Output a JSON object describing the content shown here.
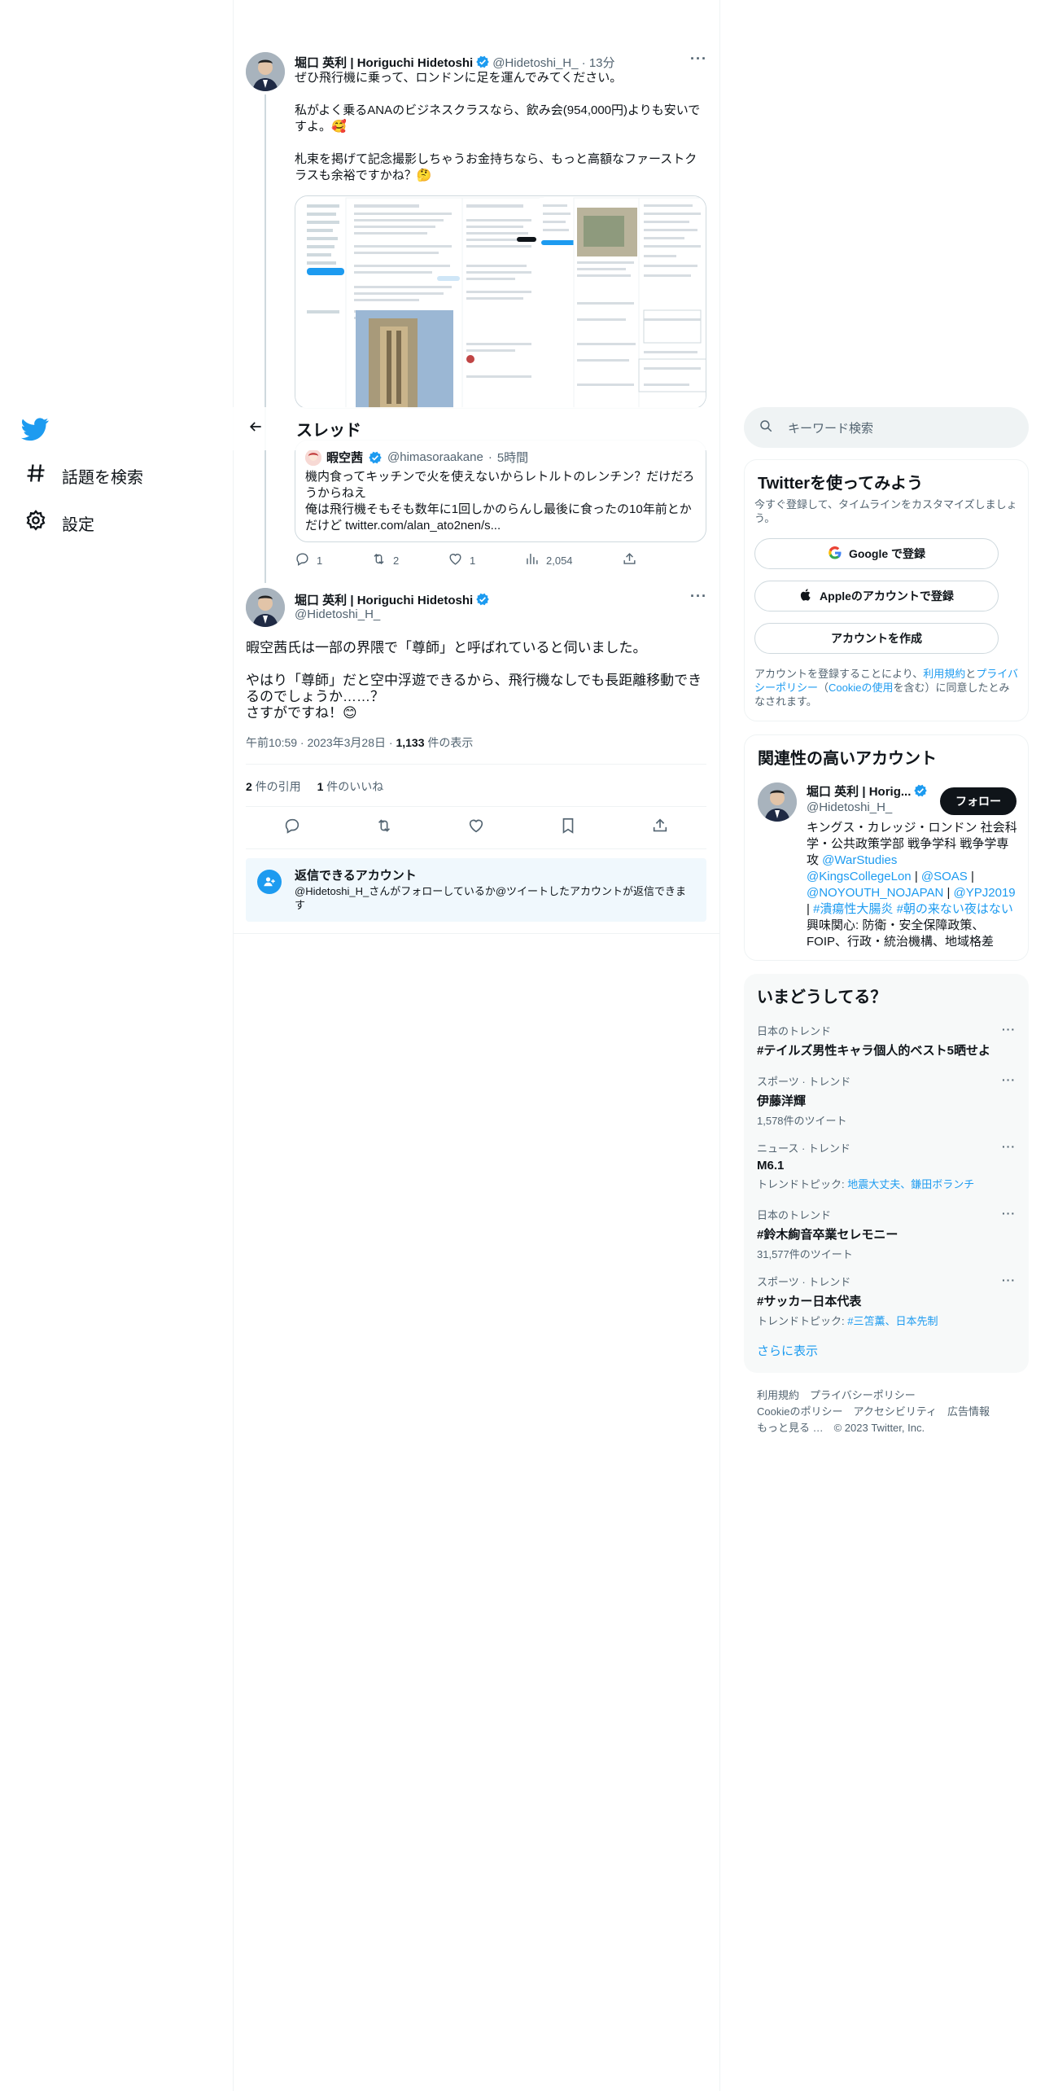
{
  "nav": {
    "explore_label": "話題を検索",
    "settings_label": "設定"
  },
  "thread_header": {
    "title": "スレッド"
  },
  "parent_tweet": {
    "name": "堀口 英利 | Horiguchi Hidetoshi",
    "handle": "@Hidetoshi_H_",
    "time": "13分",
    "text": "ぜひ飛行機に乗って、ロンドンに足を運んでみてください。\n\n私がよく乗るANAのビジネスクラスなら、飲み会(954,000円)よりも安いですよ。🥰\n\n札束を掲げて記念撮影しちゃうお金持ちなら、もっと高額なファーストクラスも余裕ですかね？🤔",
    "quote": {
      "name": "暇空茜",
      "handle": "@himasoraakane",
      "time": "5時間",
      "text": "機内食ってキッチンで火を使えないからレトルトのレンチン？だけだろうからねえ\n俺は飛行機そもそも数年に1回しかのらんし最後に食ったの10年前とかだけど twitter.com/alan_ato2nen/s..."
    },
    "actions": {
      "reply": "1",
      "retweet": "2",
      "like": "1",
      "views": "2,054"
    }
  },
  "main_tweet": {
    "name": "堀口 英利 | Horiguchi Hidetoshi",
    "handle": "@Hidetoshi_H_",
    "text": "暇空茜氏は一部の界隈で「尊師」と呼ばれていると伺いました。\n\nやはり「尊師」だと空中浮遊できるから、飛行機なしでも長距離移動できるのでしょうか……？\nさすがですね！😊",
    "time": "午前10:59",
    "date": "2023年3月28日",
    "views_count": "1,133",
    "views_label": "件の表示",
    "quotes_count": "2",
    "quotes_label": "件の引用",
    "likes_count": "1",
    "likes_label": "件のいいね"
  },
  "reply_restriction": {
    "title": "返信できるアカウント",
    "text": "@Hidetoshi_H_さんがフォローしているか@ツイートしたアカウントが返信できます"
  },
  "search": {
    "placeholder": "キーワード検索"
  },
  "signup": {
    "title": "Twitterを使ってみよう",
    "subtitle": "今すぐ登録して、タイムラインをカスタマイズしましょう。",
    "google": "Google で登録",
    "apple": "Appleのアカウントで登録",
    "create": "アカウントを作成",
    "legal_prefix": "アカウントを登録することにより、",
    "terms": "利用規約",
    "and": "と",
    "privacy": "プライバシーポリシー",
    "cookie_open": "（",
    "cookie": "Cookieの使用",
    "legal_suffix": "を含む）に同意したとみなされます。"
  },
  "relevant": {
    "title": "関連性の高いアカウント",
    "name": "堀口 英利 | Horig...",
    "handle": "@Hidetoshi_H_",
    "follow": "フォロー",
    "bio_1": "キングス・カレッジ・ロンドン 社会科学・公共政策学部 戦争学科 戦争学専攻 ",
    "bio_link_1": "@WarStudies",
    "bio_link_2": "@KingsCollegeLon",
    "bio_sep": " | ",
    "bio_link_3": "@SOAS",
    "bio_link_4": "@NOYOUTH_NOJAPAN",
    "bio_link_5": "@YPJ2019",
    "bio_link_6": "#潰瘍性大腸炎",
    "bio_link_7": "#朝の来ない夜はない",
    "bio_2": "興味関心: 防衛・安全保障政策、FOIP、行政・統治機構、地域格差"
  },
  "trends": {
    "title": "いまどうしてる？",
    "items": [
      {
        "context": "日本のトレンド",
        "name": "#テイルズ男性キャラ個人的ベスト5晒せよ",
        "sub": ""
      },
      {
        "context": "スポーツ · トレンド",
        "name": "伊藤洋輝",
        "sub": "1,578件のツイート"
      },
      {
        "context": "ニュース · トレンド",
        "name": "M6.1",
        "sub_prefix": "トレンドトピック: ",
        "sub_link": "地震大丈夫、鎌田ボランチ"
      },
      {
        "context": "日本のトレンド",
        "name": "#鈴木絢音卒業セレモニー",
        "sub": "31,577件のツイート"
      },
      {
        "context": "スポーツ · トレンド",
        "name": "#サッカー日本代表",
        "sub_prefix": "トレンドトピック: ",
        "sub_link": "#三笘薫、日本先制"
      }
    ],
    "show_more": "さらに表示"
  },
  "footer": {
    "line1": "利用規約　プライバシーポリシー",
    "line2": "Cookieのポリシー　アクセシビリティ　広告情報",
    "line3": "もっと見る …　© 2023 Twitter, Inc."
  },
  "colors": {
    "accent": "#1d9bf0",
    "text": "#0f1419",
    "muted": "#536471"
  }
}
